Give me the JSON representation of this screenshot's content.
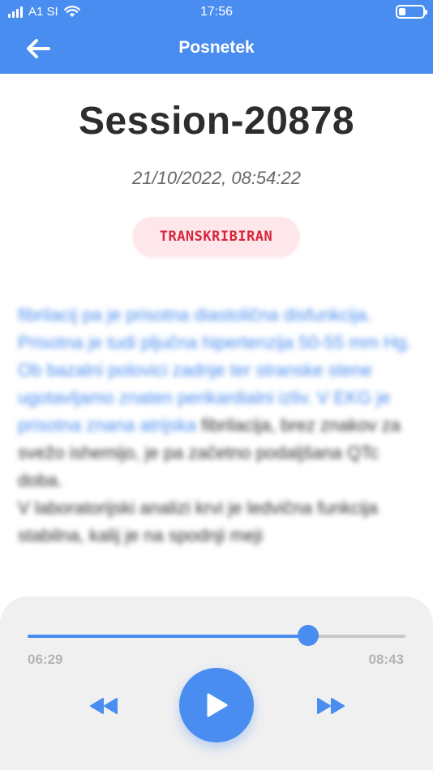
{
  "status_bar": {
    "carrier": "A1 SI",
    "time": "17:56",
    "icons": [
      "signal-icon",
      "wifi-icon",
      "battery-icon"
    ]
  },
  "nav": {
    "title": "Posnetek",
    "back_icon": "arrow-left-icon"
  },
  "recording": {
    "title": "Session-20878",
    "timestamp": "21/10/2022, 08:54:22",
    "status_badge": "TRANSKRIBIRAN"
  },
  "transcript": {
    "highlighted": "fibrilacij pa je prisotna diastolična disfunkcija. Prisotna je tudi pljučna hipertenzija 50-55 mm Hg. Ob bazalni polovici zadnje ter stranske stene ugotavljamo znaten perikardialni izliv. V EKG je prisotna znana atrijska",
    "rest": "fibrilacija, brez znakov za svežo ishemijo, je pa začetno podaljšana QTc doba.",
    "rest2": "V laboratorijski analizi krvi je ledvična funkcija stabilna, kalij je na spodnji meji"
  },
  "player": {
    "current_time": "06:29",
    "total_time": "08:43",
    "progress": 0.742,
    "rewind_icon": "rewind-icon",
    "play_icon": "play-icon",
    "forward_icon": "fast-forward-icon"
  },
  "colors": {
    "primary": "#4a8df0",
    "badge_bg": "#fde7ea",
    "badge_text": "#d7263d",
    "player_bg": "#f0f0f0"
  }
}
